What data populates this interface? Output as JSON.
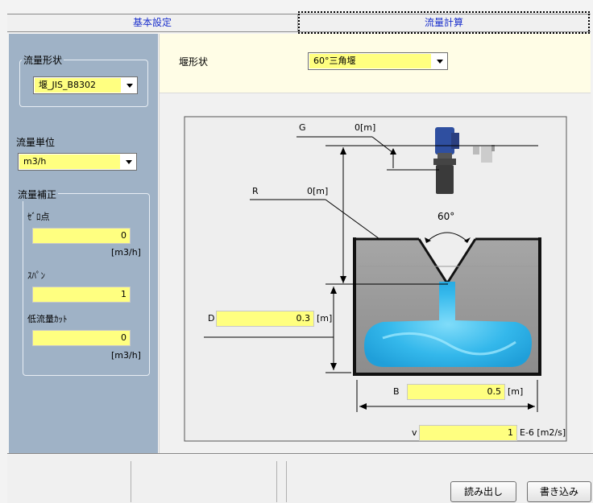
{
  "tabs": [
    {
      "label": "基本設定"
    },
    {
      "label": "流量計算"
    }
  ],
  "left": {
    "flow_shape": {
      "title": "流量形状",
      "value": "堰_JIS_B8302"
    },
    "flow_unit": {
      "title": "流量単位",
      "value": "m3/h"
    },
    "flow_correction": {
      "title": "流量補正",
      "zero": {
        "label": "ｾﾞﾛ点",
        "value": "0",
        "unit": "[m3/h]"
      },
      "span": {
        "label": "ｽﾊﾟﾝ",
        "value": "1"
      },
      "low_cut": {
        "label": "低流量ｶｯﾄ",
        "value": "0",
        "unit": "[m3/h]"
      }
    }
  },
  "right": {
    "weir_shape": {
      "label": "堰形状",
      "value": "60°三角堰"
    },
    "diagram": {
      "G": {
        "label": "G",
        "value": "0[m]"
      },
      "R": {
        "label": "R",
        "value": "0[m]"
      },
      "angle": "60°",
      "D": {
        "label": "D",
        "value": "0.3",
        "unit": "[m]"
      },
      "B": {
        "label": "B",
        "value": "0.5",
        "unit": "[m]"
      },
      "v": {
        "label": "v",
        "value": "1",
        "unit": "E-6 [m2/s]"
      }
    }
  },
  "buttons": {
    "read": "読み出し",
    "write": "書き込み"
  },
  "colors": {
    "panel": "#9fb2c6",
    "input": "#ffff80",
    "water": "#29b8f0",
    "tab_text": "#1a2fcc"
  }
}
